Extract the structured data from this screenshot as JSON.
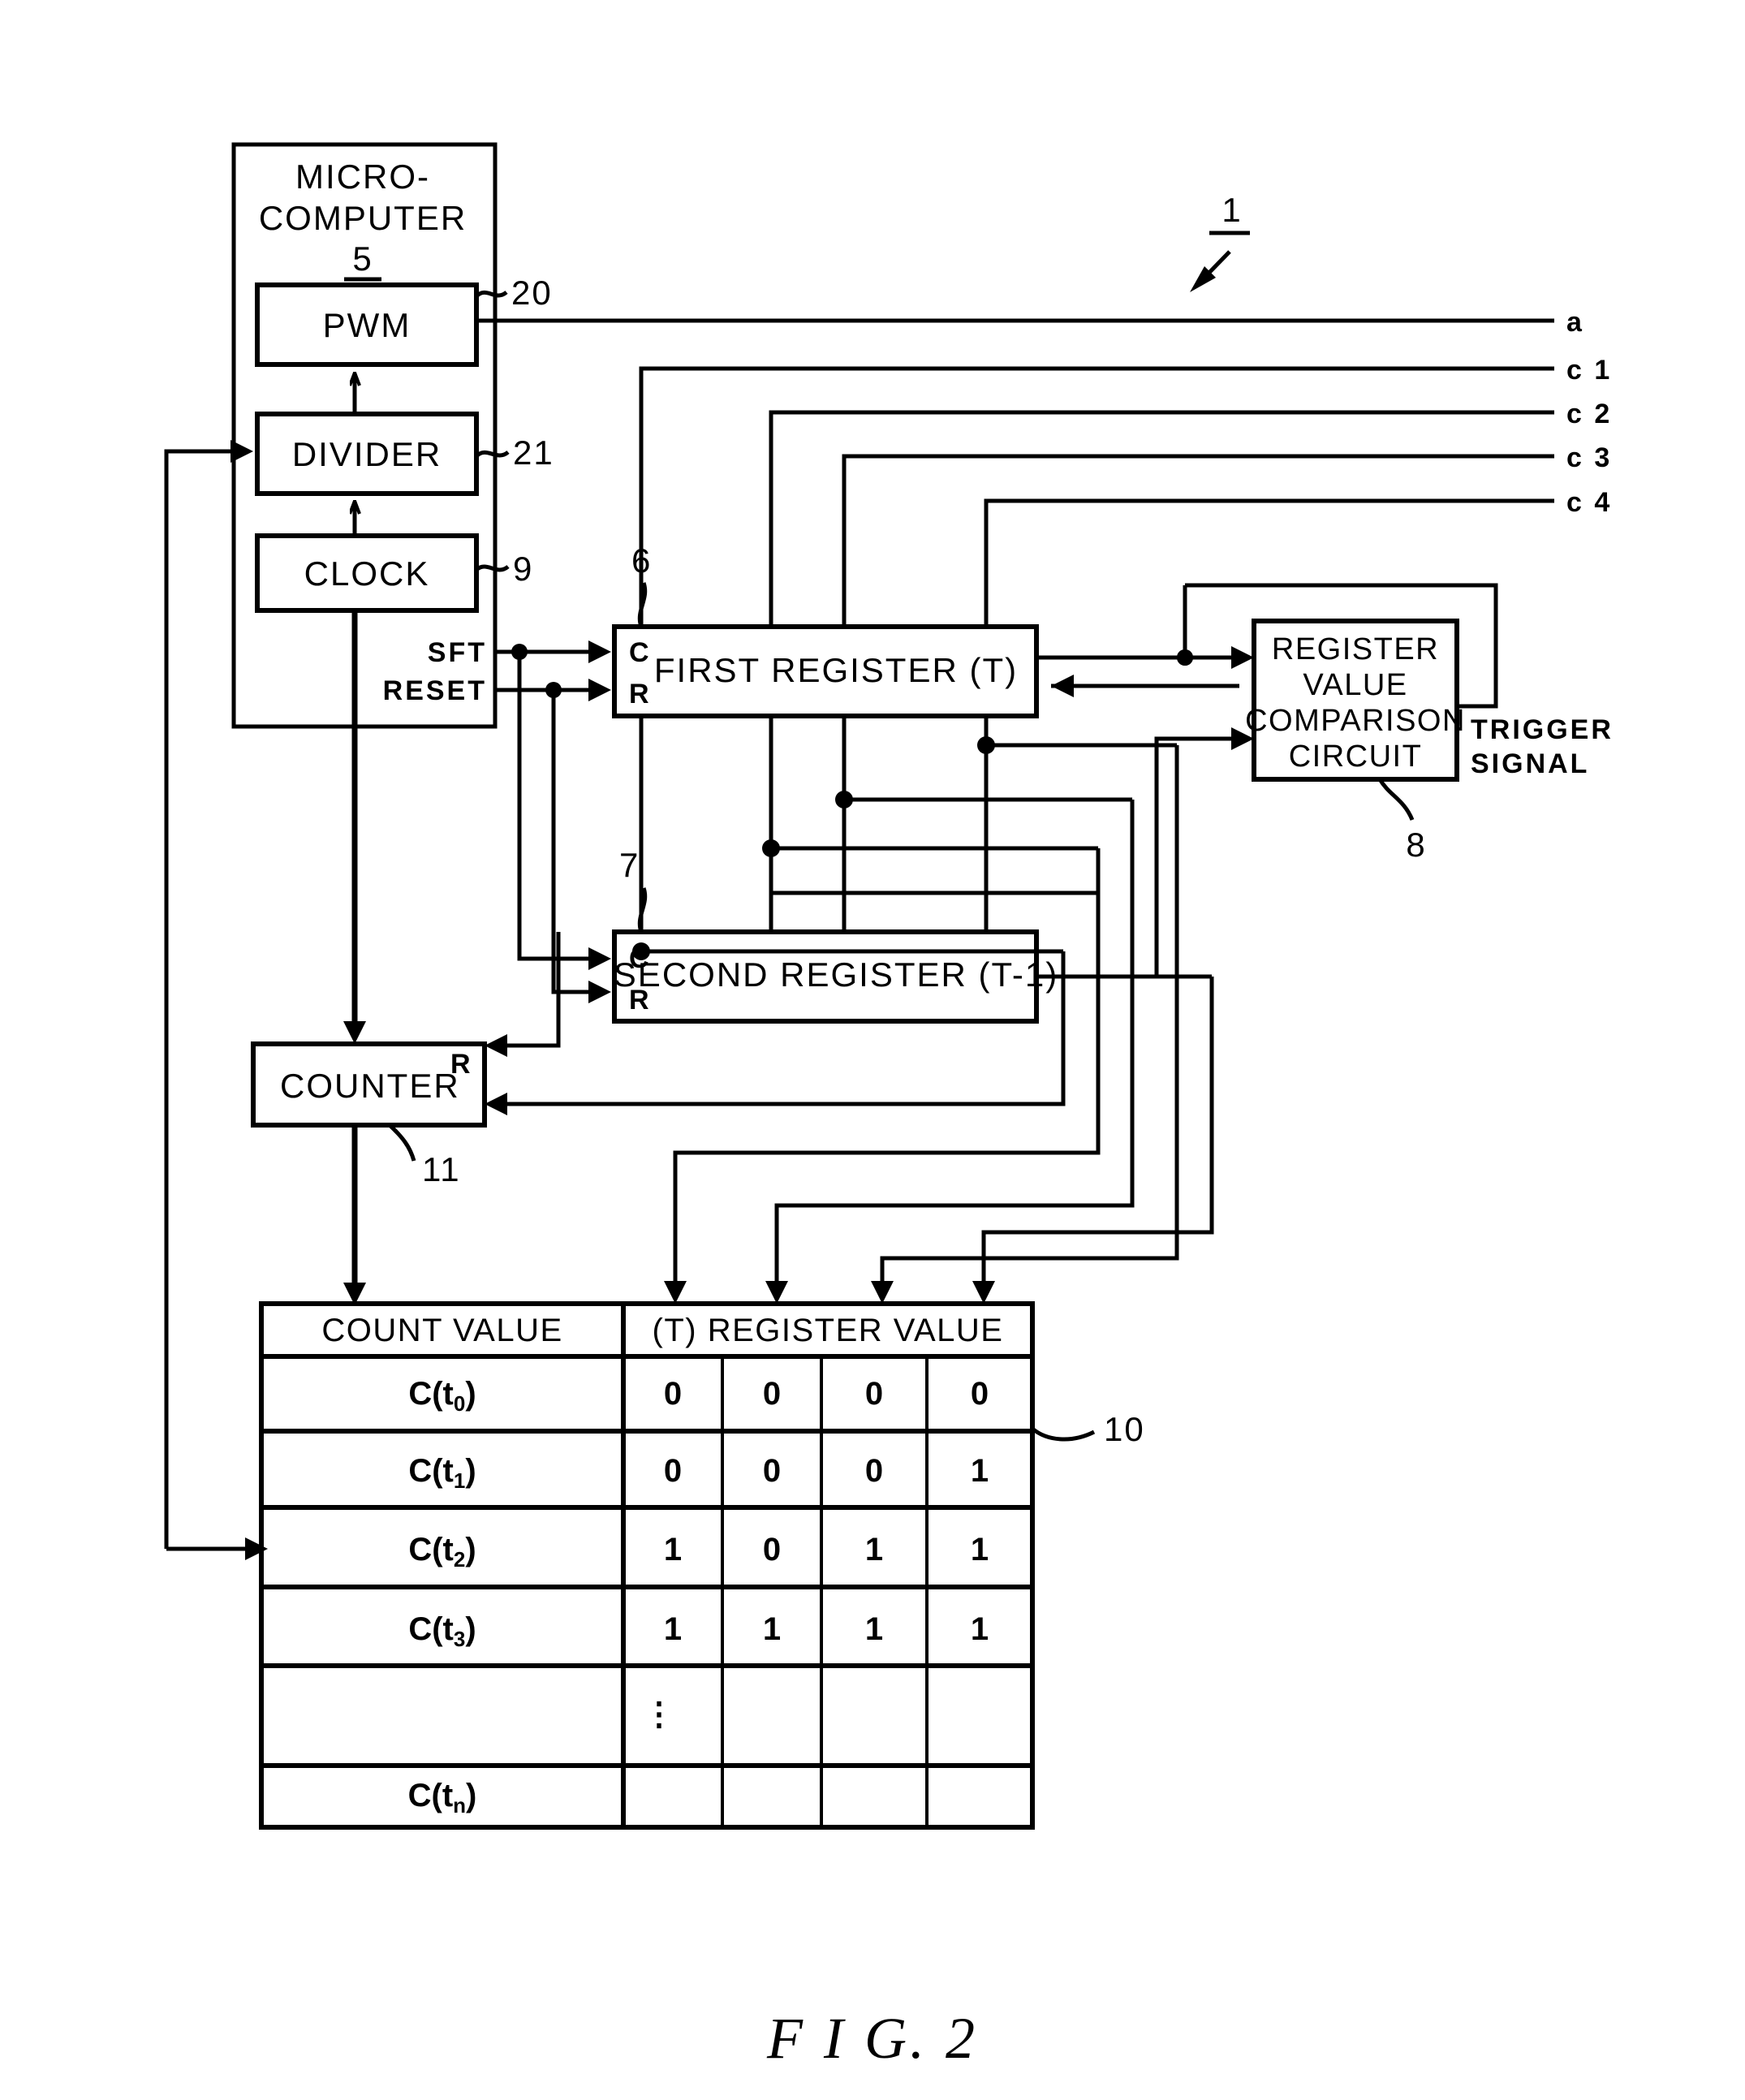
{
  "figure": {
    "caption": "F I G. 2",
    "system_ref": "1"
  },
  "blocks": {
    "microcomputer": {
      "line1": "MICRO-",
      "line2": "COMPUTER",
      "ref": "5"
    },
    "pwm": {
      "label": "PWM",
      "ref": "20"
    },
    "divider": {
      "label": "DIVIDER",
      "ref": "21"
    },
    "clock": {
      "label": "CLOCK",
      "ref": "9"
    },
    "first_register": {
      "label": "FIRST REGISTER  (T)",
      "ref": "6",
      "clock_pin": "C",
      "reset_pin": "R"
    },
    "second_register": {
      "label": "SECOND REGISTER  (T-1)",
      "ref": "7",
      "clock_pin": "C",
      "reset_pin": "R"
    },
    "comparison": {
      "line1": "REGISTER",
      "line2": "VALUE",
      "line3": "COMPARISON",
      "line4": "CIRCUIT",
      "ref": "8"
    },
    "counter": {
      "label": "COUNTER",
      "reset_pin": "R",
      "ref": "11"
    },
    "table": {
      "ref": "10"
    }
  },
  "signals": {
    "sft": "SFT",
    "reset": "RESET",
    "trigger_line1": "TRIGGER",
    "trigger_line2": "SIGNAL",
    "outputs": [
      {
        "name": "a"
      },
      {
        "name": "c 1"
      },
      {
        "name": "c 2"
      },
      {
        "name": "c 3"
      },
      {
        "name": "c 4"
      }
    ]
  },
  "chart_data": {
    "type": "table",
    "title": "(T) REGISTER VALUE table",
    "headers": [
      "COUNT VALUE",
      "(T) REGISTER VALUE"
    ],
    "rows": [
      {
        "label": "C(t",
        "sub": "0",
        "close": ")",
        "bits": [
          "0",
          "0",
          "0",
          "0"
        ]
      },
      {
        "label": "C(t",
        "sub": "1",
        "close": ")",
        "bits": [
          "0",
          "0",
          "0",
          "1"
        ]
      },
      {
        "label": "C(t",
        "sub": "2",
        "close": ")",
        "bits": [
          "1",
          "0",
          "1",
          "1"
        ]
      },
      {
        "label": "C(t",
        "sub": "3",
        "close": ")",
        "bits": [
          "1",
          "1",
          "1",
          "1"
        ]
      },
      {
        "label": "",
        "sub": "",
        "close": "",
        "bits": [
          "",
          "",
          "",
          ""
        ],
        "ellipsis": "⋮"
      },
      {
        "label": "C(t",
        "sub": "n",
        "close": ")",
        "bits": [
          "",
          "",
          "",
          ""
        ]
      }
    ]
  }
}
